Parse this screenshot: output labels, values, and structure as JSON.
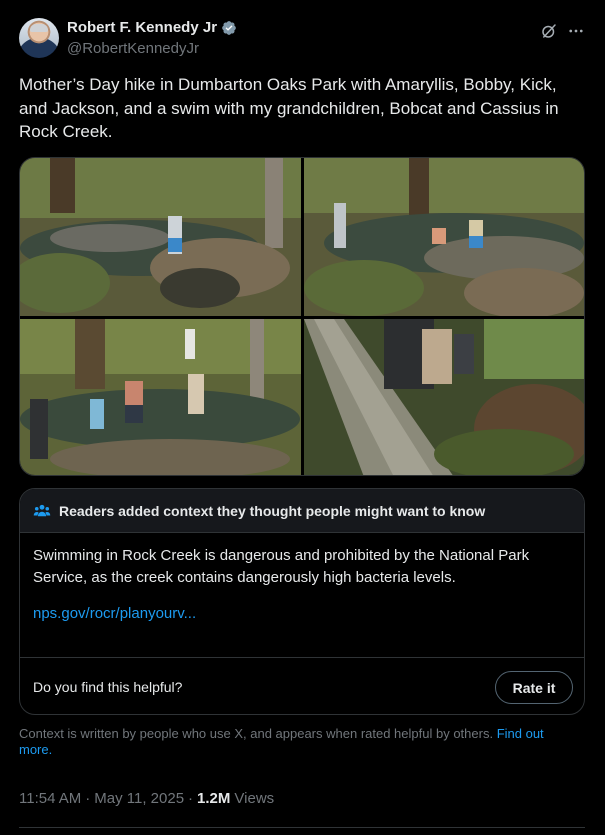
{
  "author": {
    "name": "Robert F. Kennedy Jr",
    "handle": "@RobertKennedyJr",
    "verified_icon": "verified-badge-icon",
    "verified_color": "#829aab"
  },
  "actions": {
    "grok_icon": "grok-icon",
    "more_icon": "more-options-icon"
  },
  "tweet": {
    "text": "Mother’s Day hike in Dumbarton Oaks Park with Amaryllis, Bobby, Kick,\nand Jackson, and a swim with my grandchildren, Bobcat and Cassius in\nRock Creek."
  },
  "media": {
    "photo_count": 4,
    "photos": [
      "photo-creek-rocks",
      "photo-creek-wading",
      "photo-creek-group",
      "photo-fallen-tree"
    ]
  },
  "community_note": {
    "title": "Readers added context they thought people might want to know",
    "body": "Swimming in Rock Creek is dangerous and prohibited by the National Park Service, as the creek contains dangerously high bacteria levels.",
    "url": "nps.gov/rocr/planyourv...",
    "helpful_question": "Do you find this helpful?",
    "rate_label": "Rate it",
    "icon": "people-icon",
    "icon_color": "#1d9bf0"
  },
  "context_footer": {
    "text": "Context is written by people who use X, and appears when rated helpful by others.",
    "link": "Find out more."
  },
  "meta": {
    "time": "11:54 AM",
    "separator": "·",
    "date": "May 11, 2025",
    "views_count": "1.2M",
    "views_label": "Views"
  },
  "colors": {
    "background": "#000000",
    "text": "#e7e9ea",
    "secondary": "#71767b",
    "link": "#1d9bf0",
    "border": "#2f3336"
  }
}
